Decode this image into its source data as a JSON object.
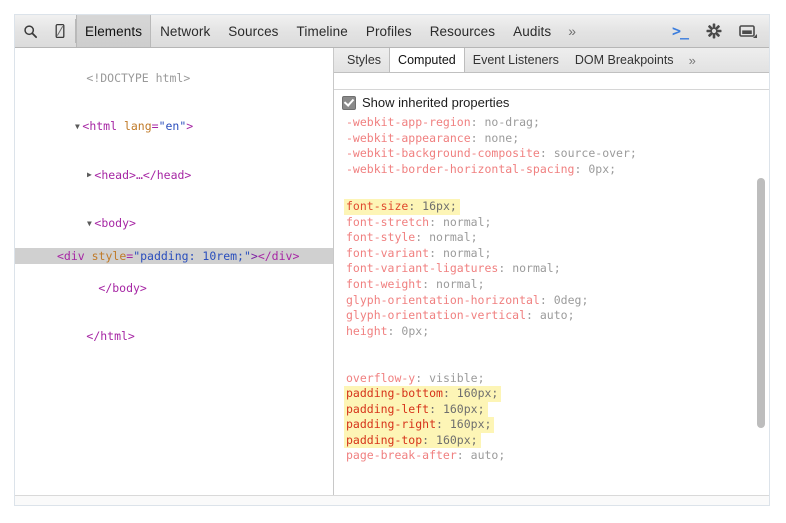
{
  "window": {
    "title": "Chrome DevTools — Elements / Computed"
  },
  "toolbar": {
    "search_icon": "search-icon",
    "device_icon": "device-toggle-icon",
    "tabs": [
      {
        "label": "Elements",
        "active": true
      },
      {
        "label": "Network",
        "active": false
      },
      {
        "label": "Sources",
        "active": false
      },
      {
        "label": "Timeline",
        "active": false
      },
      {
        "label": "Profiles",
        "active": false
      },
      {
        "label": "Resources",
        "active": false
      },
      {
        "label": "Audits",
        "active": false
      }
    ],
    "more_tabs_label": "»",
    "console_glyph": ">_",
    "console_color": "#3b7ddd",
    "settings_icon": "gear-icon",
    "dock_icon": "dock-position-icon"
  },
  "dom_tree": {
    "rows": [
      {
        "twisty": "",
        "indent": 1,
        "selected": false,
        "parts": [
          {
            "cls": "doctype",
            "text": "<!DOCTYPE html>"
          }
        ]
      },
      {
        "twisty": "▼",
        "indent": 0,
        "selected": false,
        "parts": [
          {
            "cls": "tag",
            "text": "<html "
          },
          {
            "cls": "attr-name",
            "text": "lang"
          },
          {
            "cls": "tag",
            "text": "="
          },
          {
            "cls": "attr-val",
            "text": "\"en\""
          },
          {
            "cls": "tag",
            "text": ">"
          }
        ]
      },
      {
        "twisty": "▶",
        "indent": 1,
        "selected": false,
        "parts": [
          {
            "cls": "tag",
            "text": "<head>"
          },
          {
            "cls": "ellipsis",
            "text": "…"
          },
          {
            "cls": "tag",
            "text": "</head>"
          }
        ]
      },
      {
        "twisty": "▼",
        "indent": 1,
        "selected": false,
        "parts": [
          {
            "cls": "tag",
            "text": "<body>"
          }
        ]
      },
      {
        "twisty": "",
        "indent": 3,
        "selected": true,
        "parts": [
          {
            "cls": "tag",
            "text": "<div "
          },
          {
            "cls": "attr-name",
            "text": "style"
          },
          {
            "cls": "tag",
            "text": "="
          },
          {
            "cls": "attr-val",
            "text": "\"padding: 10rem;\""
          },
          {
            "cls": "punct",
            "text": ">"
          },
          {
            "cls": "tag",
            "text": "</div>"
          }
        ]
      },
      {
        "twisty": "",
        "indent": 2,
        "selected": false,
        "parts": [
          {
            "cls": "tag",
            "text": "</body>"
          }
        ]
      },
      {
        "twisty": "",
        "indent": 1,
        "selected": false,
        "parts": [
          {
            "cls": "tag",
            "text": "</html>"
          }
        ]
      }
    ]
  },
  "sidebar": {
    "tabs": [
      {
        "label": "Styles",
        "active": false
      },
      {
        "label": "Computed",
        "active": true
      },
      {
        "label": "Event Listeners",
        "active": false
      },
      {
        "label": "DOM Breakpoints",
        "active": false
      }
    ],
    "more_tabs_label": "»",
    "show_inherited_label": "Show inherited properties",
    "show_inherited_checked": true,
    "computed_properties": [
      {
        "name": "-webkit-app-region",
        "value": "no-drag",
        "highlight": false,
        "strong": false
      },
      {
        "name": "-webkit-appearance",
        "value": "none",
        "highlight": false,
        "strong": false
      },
      {
        "name": "-webkit-background-composite",
        "value": "source-over",
        "highlight": false,
        "strong": false
      },
      {
        "name": "-webkit-border-horizontal-spacing",
        "value": "0px",
        "highlight": false,
        "strong": false
      },
      {
        "name": "font-size",
        "value": "16px",
        "highlight": true,
        "strong": false
      },
      {
        "name": "font-stretch",
        "value": "normal",
        "highlight": false,
        "strong": false
      },
      {
        "name": "font-style",
        "value": "normal",
        "highlight": false,
        "strong": false
      },
      {
        "name": "font-variant",
        "value": "normal",
        "highlight": false,
        "strong": false
      },
      {
        "name": "font-variant-ligatures",
        "value": "normal",
        "highlight": false,
        "strong": false
      },
      {
        "name": "font-weight",
        "value": "normal",
        "highlight": false,
        "strong": false
      },
      {
        "name": "glyph-orientation-horizontal",
        "value": "0deg",
        "highlight": false,
        "strong": false
      },
      {
        "name": "glyph-orientation-vertical",
        "value": "auto",
        "highlight": false,
        "strong": false
      },
      {
        "name": "height",
        "value": "0px",
        "highlight": false,
        "strong": false
      },
      {
        "name": "overflow-y",
        "value": "visible",
        "highlight": false,
        "strong": false
      },
      {
        "name": "padding-bottom",
        "value": "160px",
        "highlight": true,
        "strong": true
      },
      {
        "name": "padding-left",
        "value": "160px",
        "highlight": true,
        "strong": true
      },
      {
        "name": "padding-right",
        "value": "160px",
        "highlight": true,
        "strong": true
      },
      {
        "name": "padding-top",
        "value": "160px",
        "highlight": true,
        "strong": true
      },
      {
        "name": "page-break-after",
        "value": "auto",
        "highlight": false,
        "strong": false
      }
    ],
    "gap_after_indices": [
      3,
      12
    ],
    "highlight_color": "#fdf5b6"
  }
}
